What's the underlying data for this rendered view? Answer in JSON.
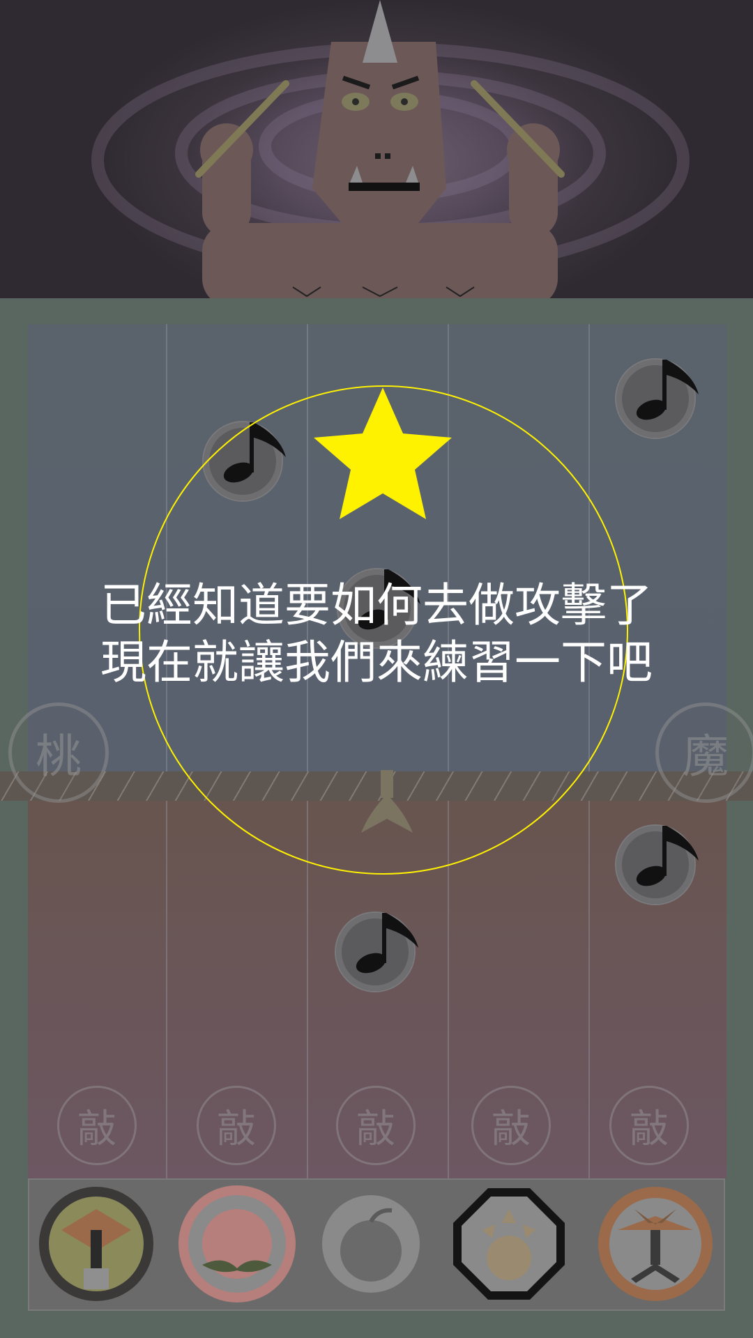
{
  "scene": {
    "name": "oni-drummer",
    "background": "swirl-vortex"
  },
  "board": {
    "lanes": 5,
    "left_marker": "桃",
    "right_marker": "魔",
    "hit_labels": [
      "敲",
      "敲",
      "敲",
      "敲",
      "敲"
    ],
    "notes_top_icons": [
      "music-note-icon",
      "music-note-icon",
      "music-note-icon"
    ],
    "notes_bottom_icons": [
      "music-note-icon",
      "music-note-icon"
    ]
  },
  "tutorial": {
    "line1": "已經知道要如何去做攻擊了",
    "line2": "現在就讓我們來練習一下吧",
    "highlight_icon": "star-icon",
    "star_color": "#FFF200",
    "ring_color": "#FFF200"
  },
  "toolbar": {
    "items": [
      {
        "icon": "hammer-shield-icon",
        "color": "#8b8a5a"
      },
      {
        "icon": "peach-icon",
        "color": "#b77f7b"
      },
      {
        "icon": "bomb-icon",
        "color": "#6a6a6a"
      },
      {
        "icon": "octagon-spark-icon",
        "color": "#111111"
      },
      {
        "icon": "drum-stand-icon",
        "color": "#9a6a4a"
      }
    ]
  }
}
